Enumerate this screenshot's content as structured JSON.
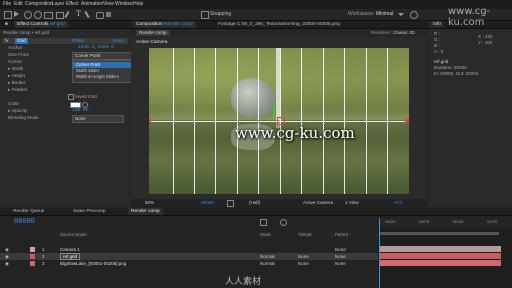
{
  "menu": [
    "File",
    "Edit",
    "Composition",
    "Layer",
    "Effect",
    "Animation",
    "View",
    "Window",
    "Help"
  ],
  "toolbar": {
    "snapping": "Snapping",
    "workspace_label": "Workspace:",
    "workspace_value": "Minimal"
  },
  "left_panel": {
    "tab_label": "Effect Controls",
    "tab_name": "ref grid",
    "breadcrumb": "Render comp • ref grid",
    "effect_name": "Grid",
    "reset_label": "Reset",
    "about_label": "About...",
    "props": [
      {
        "name": "Anchor",
        "value": "1440.0,1080.0"
      },
      {
        "name": "Size From",
        "value": "Corner Point"
      },
      {
        "name": "Corner",
        "value": ""
      },
      {
        "name": "Width",
        "value": ""
      },
      {
        "name": "Height",
        "value": ""
      },
      {
        "name": "Border",
        "value": ""
      },
      {
        "name": "Feather",
        "value": ""
      },
      {
        "name": "",
        "value": "Invert Grid"
      },
      {
        "name": "Color",
        "value": ""
      },
      {
        "name": "Opacity",
        "value": "100.0%"
      },
      {
        "name": "Blending Mode",
        "value": "None"
      }
    ],
    "dropdown_options": [
      "Corner Point",
      "Width Slider",
      "Width & Height Sliders"
    ]
  },
  "comp_panel": {
    "tab_label": "Composition",
    "tab_name": "Render comp",
    "footage_tab": "Footage C:\\M_0_396_TeamSwimming_20000-00205.png",
    "sub_tab": "Render comp",
    "renderer_label": "Renderer:",
    "renderer_value": "Classic 3D",
    "camera_label": "Active Camera",
    "watermark": "www.cg-ku.com",
    "bottom": {
      "zoom": "50%",
      "timecode": "00000",
      "resolution": "(Half)",
      "camera": "Active Camera",
      "views": "1 View",
      "offset": "+0.0"
    }
  },
  "info_panel": {
    "title": "Info",
    "r": "R :",
    "g": "G :",
    "b": "B :",
    "a": "A : 0",
    "x": "X : 432",
    "y": "Y : 402",
    "layer": "ref grid",
    "duration": "Duration: 00205",
    "in_out": "In: 00000, Out: 00204"
  },
  "timeline": {
    "tabs": [
      "Render Queue",
      "Swan Precomp",
      "Render comp"
    ],
    "timecode": "00000",
    "columns": {
      "name": "Source Name",
      "mode": "Mode",
      "trkmat": "TrkMat",
      "parent": "Parent"
    },
    "layers": [
      {
        "num": "1",
        "name": "Camera 1",
        "mode": "",
        "trkmat": "",
        "parent": "None",
        "color": "#c9a4a4"
      },
      {
        "num": "2",
        "name": "ref grid",
        "mode": "Normal",
        "trkmat": "None",
        "parent": "None",
        "color": "#c95b62"
      },
      {
        "num": "3",
        "name": "BigSlowLake_[00001-00205].png",
        "mode": "Normal",
        "trkmat": "None",
        "parent": "None",
        "color": "#d06a72"
      }
    ],
    "ruler": [
      "00025",
      "00050",
      "00075",
      "00100",
      "00125",
      "00150",
      "00175",
      "00200"
    ]
  },
  "watermarks": {
    "top": "www.cg-ku.com",
    "bottom": "人人素材"
  },
  "colors": {
    "accent": "#3d8fdc",
    "layer_red": "#c95b62",
    "playhead": "#3d8fdc"
  }
}
